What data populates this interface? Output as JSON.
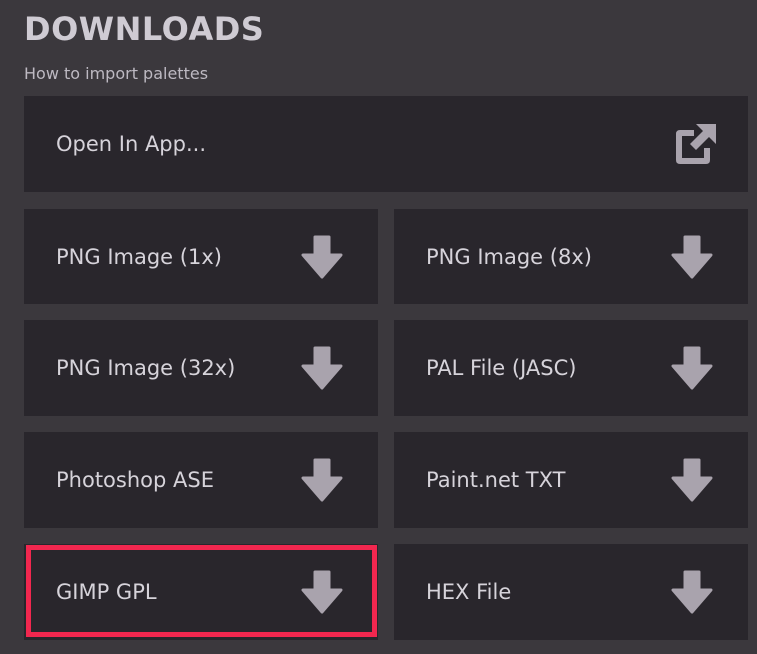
{
  "header": {
    "title": "DOWNLOADS",
    "subtitle": "How to import palettes"
  },
  "open_in_app": {
    "label": "Open In App...",
    "icon": "external-link-icon"
  },
  "downloads": [
    {
      "label": "PNG Image (1x)",
      "icon": "download-arrow-icon"
    },
    {
      "label": "PNG Image (8x)",
      "icon": "download-arrow-icon"
    },
    {
      "label": "PNG Image (32x)",
      "icon": "download-arrow-icon"
    },
    {
      "label": "PAL File (JASC)",
      "icon": "download-arrow-icon"
    },
    {
      "label": "Photoshop ASE",
      "icon": "download-arrow-icon"
    },
    {
      "label": "Paint.net TXT",
      "icon": "download-arrow-icon"
    },
    {
      "label": "GIMP GPL",
      "icon": "download-arrow-icon",
      "highlighted": true
    },
    {
      "label": "HEX File",
      "icon": "download-arrow-icon"
    }
  ],
  "colors": {
    "background": "#3b383d",
    "button": "#29262c",
    "icon": "#a9a3ad",
    "highlight": "#f2274f"
  }
}
